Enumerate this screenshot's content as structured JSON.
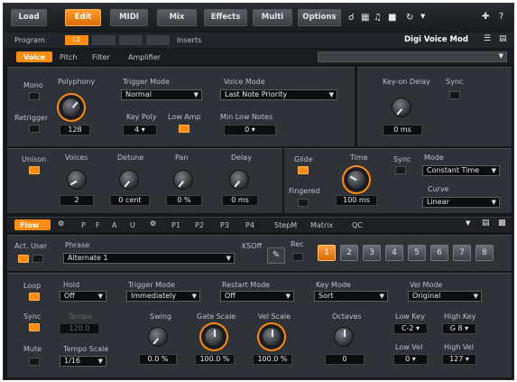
{
  "tabs": [
    {
      "label": "Load",
      "active": false
    },
    {
      "label": "Edit",
      "active": true
    },
    {
      "label": "MIDI",
      "active": false
    },
    {
      "label": "Mix",
      "active": false
    },
    {
      "label": "Effects",
      "active": false
    },
    {
      "label": "Multi",
      "active": false
    },
    {
      "label": "Options",
      "active": false
    }
  ],
  "header": {
    "program_label": "Program",
    "program_value": "L1",
    "inserts_label": "Inserts",
    "preset_name": "Digi Voice Mod"
  },
  "subtabs": [
    "Voice",
    "Pitch",
    "Filter",
    "Amplifier"
  ],
  "voice": {
    "mono": "Mono",
    "retrigger": "Retrigger",
    "polyphony": "Polyphony",
    "polyphony_value": "128",
    "trigger_mode": "Trigger Mode",
    "trigger_mode_value": "Normal",
    "key_poly": "Key Poly",
    "key_poly_value": "4",
    "low_amp": "Low Amp",
    "voice_mode": "Voice Mode",
    "voice_mode_value": "Last Note Priority",
    "min_low_notes": "Min Low Notes",
    "min_low_notes_value": "0",
    "key_on_delay": "Key-on Delay",
    "key_on_delay_value": "0 ms",
    "sync": "Sync"
  },
  "unison": {
    "label": "Unison",
    "voices": "Voices",
    "voices_value": "2",
    "detune": "Detune",
    "detune_value": "0 cent",
    "pan": "Pan",
    "pan_value": "0 %",
    "delay": "Delay",
    "delay_value": "0 ms"
  },
  "glide": {
    "label": "Glide",
    "fingered": "Fingered",
    "time": "Time",
    "time_value": "100 ms",
    "sync": "Sync",
    "mode": "Mode",
    "mode_value": "Constant Time",
    "curve": "Curve",
    "curve_value": "Linear"
  },
  "modtabs": [
    "Flow",
    "P",
    "F",
    "A",
    "U",
    "P1",
    "P2",
    "P3",
    "P4",
    "StepM",
    "Matrix",
    "QC"
  ],
  "phrase": {
    "act_user": "Act. User",
    "phrase_label": "Phrase",
    "phrase_value": "Alternate 1",
    "ksoft": "KSOff",
    "rec": "Rec",
    "slots": [
      "1",
      "2",
      "3",
      "4",
      "5",
      "6",
      "7",
      "8"
    ]
  },
  "arp": {
    "loop": "Loop",
    "hold": "Hold",
    "hold_value": "Off",
    "trigger_mode": "Trigger Mode",
    "trigger_mode_value": "Immediately",
    "restart_mode": "Restart Mode",
    "restart_mode_value": "Off",
    "key_mode": "Key Mode",
    "key_mode_value": "Sort",
    "vel_mode": "Vel Mode",
    "vel_mode_value": "Original",
    "sync": "Sync",
    "tempo": "Tempo",
    "tempo_value": "120.0",
    "swing": "Swing",
    "swing_value": "0.0 %",
    "gate_scale": "Gate Scale",
    "gate_scale_value": "100.0 %",
    "vel_scale": "Vel Scale",
    "vel_scale_value": "100.0 %",
    "octaves": "Octaves",
    "octaves_value": "0",
    "low_key": "Low Key",
    "low_key_value": "C-2",
    "high_key": "High Key",
    "high_key_value": "G 8",
    "mute": "Mute",
    "tempo_scale": "Tempo Scale",
    "tempo_scale_value": "1/16",
    "low_vel": "Low Vel",
    "low_vel_value": "0",
    "high_vel": "High Vel",
    "high_vel_value": "127"
  }
}
